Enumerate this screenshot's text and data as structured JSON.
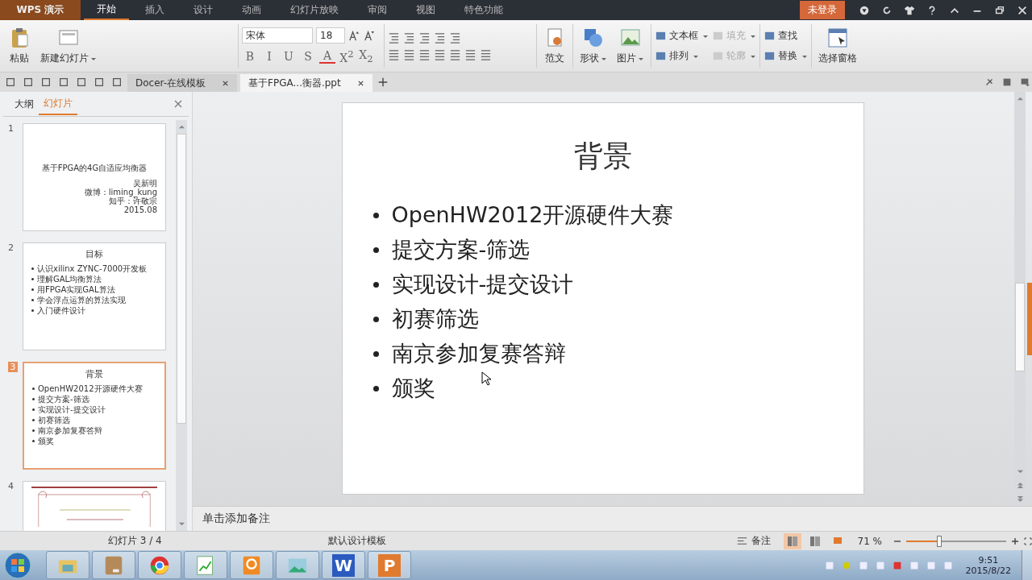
{
  "app_menu": "WPS 演示",
  "menu_tabs": [
    {
      "label": "开始",
      "selected": true
    },
    {
      "label": "插入",
      "selected": false
    },
    {
      "label": "设计",
      "selected": false
    },
    {
      "label": "动画",
      "selected": false
    },
    {
      "label": "幻灯片放映",
      "selected": false
    },
    {
      "label": "审阅",
      "selected": false
    },
    {
      "label": "视图",
      "selected": false
    },
    {
      "label": "特色功能",
      "selected": false
    }
  ],
  "account_button": "未登录",
  "ribbon": {
    "paste": "粘贴",
    "new_slide": "新建幻灯片",
    "font_name": "宋体",
    "font_size": "18",
    "format_buttons": [
      "B",
      "I",
      "U",
      "S",
      "A",
      "X$^{2}$",
      "X$_{2}$"
    ],
    "commands": [
      {
        "label": "范文",
        "kind": "large",
        "dropdown": false,
        "disabled": false
      },
      {
        "label": "形状",
        "kind": "large",
        "dropdown": true,
        "disabled": false
      },
      {
        "label": "图片",
        "kind": "large",
        "dropdown": true,
        "disabled": false
      },
      {
        "label": "文本框",
        "kind": "small",
        "dropdown": true,
        "disabled": false
      },
      {
        "label": "排列",
        "kind": "small",
        "dropdown": true,
        "disabled": false
      },
      {
        "label": "填充",
        "kind": "small",
        "dropdown": true,
        "disabled": true
      },
      {
        "label": "轮廓",
        "kind": "small",
        "dropdown": true,
        "disabled": true
      },
      {
        "label": "查找",
        "kind": "small",
        "dropdown": false,
        "disabled": false
      },
      {
        "label": "替换",
        "kind": "small",
        "dropdown": true,
        "disabled": false
      },
      {
        "label": "选择窗格",
        "kind": "large",
        "dropdown": false,
        "disabled": false
      }
    ]
  },
  "document_tabs": [
    {
      "label": "Docer-在线模板",
      "selected": false
    },
    {
      "label": "基于FPGA...衡器.ppt",
      "selected": true
    }
  ],
  "panel_tabs": [
    {
      "label": "大纲",
      "selected": false
    },
    {
      "label": "幻灯片",
      "selected": true
    }
  ],
  "thumbnails": [
    {
      "number": "1",
      "kind": "title",
      "selected": false,
      "title": "基于FPGA的4G自适应均衡器",
      "lines": [
        "吴新明",
        "微博：liming_kung",
        "知乎：许敬宗",
        "2015.08"
      ]
    },
    {
      "number": "2",
      "kind": "bullets",
      "selected": false,
      "title": "目标",
      "lines": [
        "认识xilinx ZYNC-7000开发板",
        "理解GAL均衡算法",
        "用FPGA实现GAL算法",
        "学会浮点运算的算法实现",
        "入门硬件设计"
      ]
    },
    {
      "number": "3",
      "kind": "bullets",
      "selected": true,
      "title": "背景",
      "lines": [
        "OpenHW2012开源硬件大赛",
        "提交方案-筛选",
        "实现设计-提交设计",
        "初赛筛选",
        "南京参加复赛答辩",
        "颁奖"
      ]
    },
    {
      "number": "4",
      "kind": "certificate",
      "selected": false
    }
  ],
  "slide": {
    "title": "背景",
    "bullets": [
      "OpenHW2012开源硬件大赛",
      "提交方案-筛选",
      "实现设计-提交设计",
      "初赛筛选",
      "南京参加复赛答辩",
      "颁奖"
    ]
  },
  "notes_hint": "单击添加备注",
  "status_bar": {
    "slide_counter": "幻灯片 3 / 4",
    "template": "默认设计模板",
    "notes_button": "备注",
    "views": [
      {
        "selected": true
      },
      {
        "selected": false
      },
      {
        "selected": false
      }
    ],
    "zoom": "71 %",
    "zoom_slider": {
      "level": 0.33
    }
  },
  "taskbar": {
    "apps": [
      {
        "kind": "explorer"
      },
      {
        "kind": "archive"
      },
      {
        "kind": "browser"
      },
      {
        "kind": "chart"
      },
      {
        "kind": "pdf"
      },
      {
        "kind": "photo"
      },
      {
        "kind": "word",
        "label": "W"
      },
      {
        "kind": "slides",
        "label": "P"
      }
    ],
    "time": "9:51",
    "date": "2015/8/22"
  }
}
